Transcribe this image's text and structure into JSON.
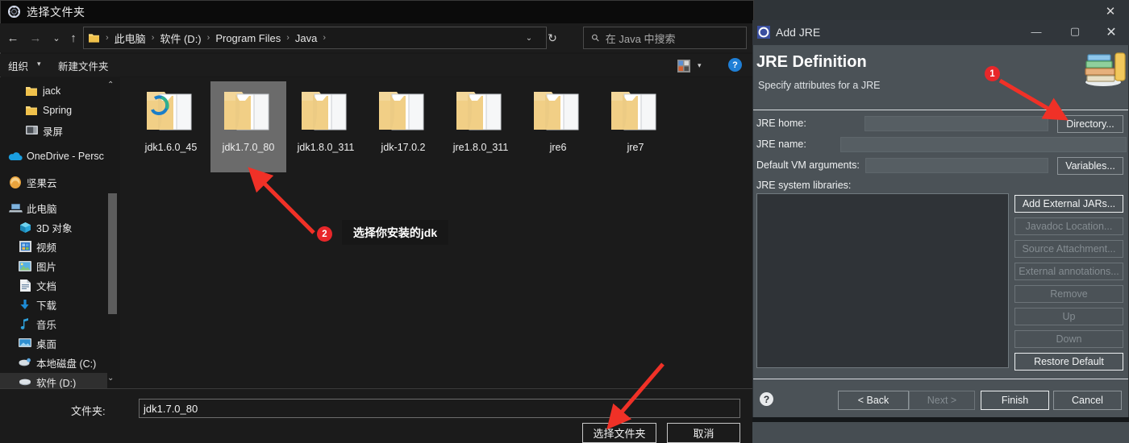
{
  "explorer": {
    "title": "选择文件夹",
    "title_icon": "folder-settings-icon",
    "close_icon": "✕",
    "nav": {
      "back_icon": "←",
      "forward_icon": "→",
      "recent_icon": "⌄",
      "up_icon": "↑",
      "dropdown_icon": "⌄",
      "refresh_icon": "↻"
    },
    "breadcrumbs": [
      "此电脑",
      "软件 (D:)",
      "Program Files",
      "Java"
    ],
    "breadcrumb_separator": "›",
    "search": {
      "placeholder": "在 Java 中搜索",
      "icon": "search-icon"
    },
    "commandbar": {
      "organize": "组织",
      "organize_caret": "▾",
      "new_folder": "新建文件夹",
      "view_caret": "▾",
      "help": "?"
    },
    "sidebar": {
      "scroll_up_icon": "⌃",
      "scroll_down_icon": "⌄",
      "items": [
        {
          "label": "jack",
          "icon": "folder-icon"
        },
        {
          "label": "Spring",
          "icon": "folder-icon"
        },
        {
          "label": "录屏",
          "icon": "screen-recording-icon"
        },
        {
          "label": "OneDrive - Persc",
          "icon": "onedrive-cloud-icon"
        },
        {
          "label": "坚果云",
          "icon": "nutstore-icon"
        },
        {
          "label": "此电脑",
          "icon": "this-pc-icon"
        },
        {
          "label": "3D 对象",
          "icon": "3d-objects-icon"
        },
        {
          "label": "视频",
          "icon": "videos-icon"
        },
        {
          "label": "图片",
          "icon": "pictures-icon"
        },
        {
          "label": "文档",
          "icon": "documents-icon"
        },
        {
          "label": "下载",
          "icon": "downloads-icon"
        },
        {
          "label": "音乐",
          "icon": "music-icon"
        },
        {
          "label": "桌面",
          "icon": "desktop-icon"
        },
        {
          "label": "本地磁盘 (C:)",
          "icon": "local-disk-icon"
        },
        {
          "label": "软件 (D:)",
          "icon": "drive-icon"
        }
      ],
      "selected_index": 14
    },
    "files": [
      {
        "name": "jdk1.6.0_45",
        "selected": false,
        "overlay": "edge-icon"
      },
      {
        "name": "jdk1.7.0_80",
        "selected": true,
        "overlay": ""
      },
      {
        "name": "jdk1.8.0_311",
        "selected": false,
        "overlay": ""
      },
      {
        "name": "jdk-17.0.2",
        "selected": false,
        "overlay": ""
      },
      {
        "name": "jre1.8.0_311",
        "selected": false,
        "overlay": ""
      },
      {
        "name": "jre6",
        "selected": false,
        "overlay": ""
      },
      {
        "name": "jre7",
        "selected": false,
        "overlay": ""
      }
    ],
    "bottom": {
      "folder_label": "文件夹:",
      "folder_value": "jdk1.7.0_80",
      "choose_button": "选择文件夹",
      "cancel_button": "取消"
    }
  },
  "jre_dialog": {
    "title": "Add JRE",
    "title_icon": "eclipse-gear-icon",
    "minimize_icon": "—",
    "maximize_icon": "▢",
    "close_icon": "✕",
    "heading": "JRE Definition",
    "subheading": "Specify attributes for a JRE",
    "banner_icon": "books-stack-icon",
    "fields": [
      {
        "label": "JRE home:",
        "value": "",
        "button": "Directory...",
        "button_mnemonic": "o"
      },
      {
        "label": "JRE name:",
        "value": "",
        "button": ""
      },
      {
        "label": "Default VM arguments:",
        "value": "",
        "button": "Variables...",
        "button_mnemonic": "i"
      }
    ],
    "libraries_label": "JRE system libraries:",
    "libraries_items": [],
    "side_buttons": [
      {
        "label": "Add External JARs...",
        "enabled": true
      },
      {
        "label": "Javadoc Location...",
        "enabled": false
      },
      {
        "label": "Source Attachment...",
        "enabled": false
      },
      {
        "label": "External annotations...",
        "enabled": false
      },
      {
        "label": "Remove",
        "enabled": false
      },
      {
        "label": "Up",
        "enabled": false
      },
      {
        "label": "Down",
        "enabled": false
      },
      {
        "label": "Restore Default",
        "enabled": true
      }
    ],
    "help_icon": "?",
    "footer_buttons": [
      {
        "label": "< Back",
        "enabled": true,
        "default": false
      },
      {
        "label": "Next >",
        "enabled": false,
        "default": false
      },
      {
        "label": "Finish",
        "enabled": true,
        "default": true
      },
      {
        "label": "Cancel",
        "enabled": true,
        "default": false
      }
    ]
  },
  "annotations": {
    "badge1": "1",
    "badge2": "2",
    "callout_text": "选择你安装的jdk",
    "arrow_color": "#f03127",
    "badge_color": "#e8272a"
  }
}
